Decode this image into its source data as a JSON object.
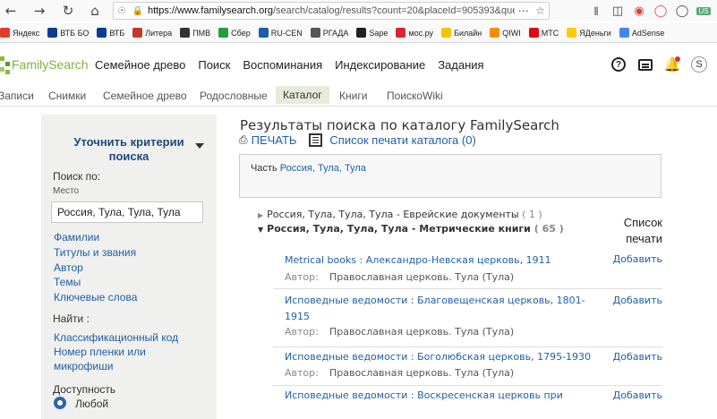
{
  "browser": {
    "url_host": "https://www.familysearch.org",
    "url_path": "/search/catalog/results?count=20&placeId=905393&que",
    "badge": "US",
    "bookmarks": [
      {
        "label": "Яндекс",
        "color": "#e53b2c"
      },
      {
        "label": "ВТБ БО",
        "color": "#0a3d91"
      },
      {
        "label": "ВТБ",
        "color": "#0a3d91"
      },
      {
        "label": "Литера",
        "color": "#c0392b"
      },
      {
        "label": "ПМВ",
        "color": "#333333"
      },
      {
        "label": "Сбер",
        "color": "#21a038"
      },
      {
        "label": "RU-CEN",
        "color": "#1b5fa8"
      },
      {
        "label": "РГАДА",
        "color": "#555555"
      },
      {
        "label": "Sape",
        "color": "#222222"
      },
      {
        "label": "мос.ру",
        "color": "#d9262a"
      },
      {
        "label": "Билайн",
        "color": "#f5c400"
      },
      {
        "label": "QIWI",
        "color": "#ff8c00"
      },
      {
        "label": "МТС",
        "color": "#e30611"
      },
      {
        "label": "ЯДеньги",
        "color": "#ffcc00"
      },
      {
        "label": "AdSense",
        "color": "#4285f4"
      }
    ]
  },
  "header": {
    "logo": "FamilySearch",
    "nav": [
      "Семейное древо",
      "Поиск",
      "Воспоминания",
      "Индексирование",
      "Задания"
    ],
    "avatar_letter": "S"
  },
  "subnav": {
    "items": [
      "Записи",
      "Снимки",
      "Семейное древо",
      "Родословные",
      "Каталог",
      "Книги",
      "ПоискоWiki"
    ],
    "active": "Каталог"
  },
  "sidebar": {
    "title": "Уточнить критерии поиска",
    "search_for": "Поиск по:",
    "place_label": "Место",
    "place_value": "Россия, Тула, Тула, Тула",
    "links": [
      "Фамилии",
      "Титулы и звания",
      "Автор",
      "Темы",
      "Ключевые слова"
    ],
    "find_label": "Найти :",
    "find_links": [
      "Классификационный код",
      "Номер пленки или микрофиши"
    ],
    "availability": "Доступность",
    "any": "Любой"
  },
  "main": {
    "title": "Результаты поиска по каталогу FamilySearch",
    "print": "ПЕЧАТЬ",
    "print_list": "Список печати каталога (0)",
    "part_label": "Часть",
    "part_value": "Россия, Тула, Тула",
    "tree": [
      {
        "label": "Россия, Тула, Тула, Тула - Еврейские документы",
        "count": "( 1 )"
      },
      {
        "label": "Россия, Тула, Тула, Тула - Метрические книги",
        "count": "( 65 )"
      }
    ],
    "print_col_header": "Список печати",
    "records": [
      {
        "title": "Metrical books : Александро-Невская церковь, 1911",
        "author_label": "Автор:",
        "author": "Православная церковь. Тула (Тула)",
        "add": "Добавить"
      },
      {
        "title": "Исповедные ведомости : Благовещенская церковь, 1801-1915",
        "author_label": "Автор:",
        "author": "Православная церковь. Тула (Тула)",
        "add": "Добавить"
      },
      {
        "title": "Исповедные ведомости : Боголюбская церковь, 1795-1930",
        "author_label": "Автор:",
        "author": "Православная церковь. Тула (Тула)",
        "add": "Добавить"
      },
      {
        "title": "Исповедные ведомости : Воскресенская церковь при",
        "author_label": "",
        "author": "",
        "add": "Добавить"
      }
    ]
  }
}
